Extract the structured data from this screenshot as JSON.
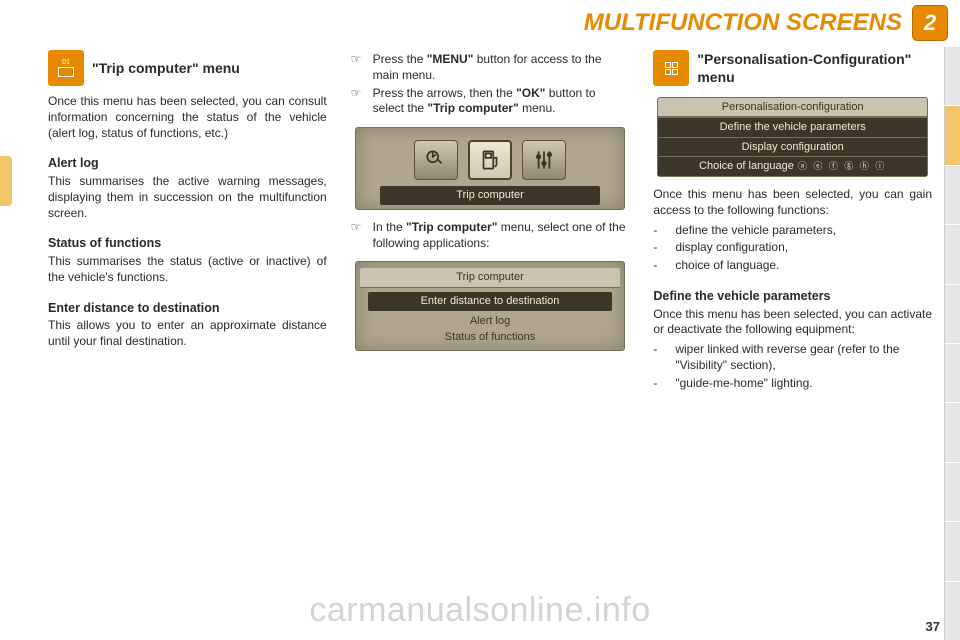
{
  "header": {
    "title": "MULTIFUNCTION SCREENS",
    "chapter": "2"
  },
  "col1": {
    "section_title": "\"Trip computer\" menu",
    "intro": "Once this menu has been selected, you can consult information concerning the status of the vehicle (alert log, status of functions, etc.)",
    "h1": "Alert log",
    "p1": "This summarises the active warning messages, displaying them in succession on the multifunction screen.",
    "h2": "Status of functions",
    "p2": "This summarises the status (active or inactive) of the vehicle's functions.",
    "h3": "Enter distance to destination",
    "p3": "This allows you to enter an approximate distance until your final destination."
  },
  "col2": {
    "l1_pre": "Press the ",
    "l1_bold": "\"MENU\"",
    "l1_post": " button for access to the main menu.",
    "l2_pre": "Press the arrows, then the ",
    "l2_bold": "\"OK\"",
    "l2_mid": " button to select the ",
    "l2_bold2": "\"Trip computer\"",
    "l2_post": " menu.",
    "screen1_caption": "Trip computer",
    "l3_pre": "In the ",
    "l3_bold": "\"Trip computer\"",
    "l3_post": " menu, select one of the following applications:",
    "screen2": {
      "header": "Trip computer",
      "line1": "Enter distance to destination",
      "line2": "Alert log",
      "line3": "Status of functions"
    }
  },
  "col3": {
    "section_title": "\"Personalisation-Configuration\" menu",
    "screen3": {
      "header": "Personalisation-configuration",
      "line1": "Define the vehicle parameters",
      "line2": "Display configuration",
      "line3": "Choice of language"
    },
    "p1": "Once this menu has been selected, you can gain access to the following functions:",
    "li1": "define the vehicle parameters,",
    "li2": "display configuration,",
    "li3": "choice of language.",
    "h1": "Define the vehicle parameters",
    "p2": "Once this menu has been selected, you can activate or deactivate the following equipment:",
    "li4": "wiper linked with reverse gear (refer to the \"Visibility\" section),",
    "li5": "\"guide-me-home\" lighting."
  },
  "footer": {
    "page": "37",
    "watermark": "carmanualsonline.info"
  }
}
